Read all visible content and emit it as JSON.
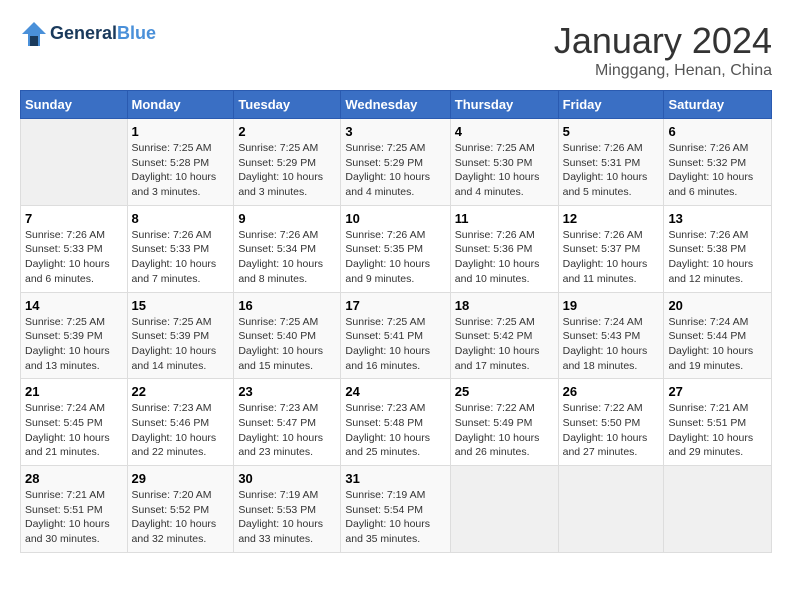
{
  "header": {
    "logo_line1": "General",
    "logo_line2": "Blue",
    "title": "January 2024",
    "subtitle": "Minggang, Henan, China"
  },
  "weekdays": [
    "Sunday",
    "Monday",
    "Tuesday",
    "Wednesday",
    "Thursday",
    "Friday",
    "Saturday"
  ],
  "weeks": [
    [
      {
        "day": "",
        "info": ""
      },
      {
        "day": "1",
        "info": "Sunrise: 7:25 AM\nSunset: 5:28 PM\nDaylight: 10 hours\nand 3 minutes."
      },
      {
        "day": "2",
        "info": "Sunrise: 7:25 AM\nSunset: 5:29 PM\nDaylight: 10 hours\nand 3 minutes."
      },
      {
        "day": "3",
        "info": "Sunrise: 7:25 AM\nSunset: 5:29 PM\nDaylight: 10 hours\nand 4 minutes."
      },
      {
        "day": "4",
        "info": "Sunrise: 7:25 AM\nSunset: 5:30 PM\nDaylight: 10 hours\nand 4 minutes."
      },
      {
        "day": "5",
        "info": "Sunrise: 7:26 AM\nSunset: 5:31 PM\nDaylight: 10 hours\nand 5 minutes."
      },
      {
        "day": "6",
        "info": "Sunrise: 7:26 AM\nSunset: 5:32 PM\nDaylight: 10 hours\nand 6 minutes."
      }
    ],
    [
      {
        "day": "7",
        "info": "Sunrise: 7:26 AM\nSunset: 5:33 PM\nDaylight: 10 hours\nand 6 minutes."
      },
      {
        "day": "8",
        "info": "Sunrise: 7:26 AM\nSunset: 5:33 PM\nDaylight: 10 hours\nand 7 minutes."
      },
      {
        "day": "9",
        "info": "Sunrise: 7:26 AM\nSunset: 5:34 PM\nDaylight: 10 hours\nand 8 minutes."
      },
      {
        "day": "10",
        "info": "Sunrise: 7:26 AM\nSunset: 5:35 PM\nDaylight: 10 hours\nand 9 minutes."
      },
      {
        "day": "11",
        "info": "Sunrise: 7:26 AM\nSunset: 5:36 PM\nDaylight: 10 hours\nand 10 minutes."
      },
      {
        "day": "12",
        "info": "Sunrise: 7:26 AM\nSunset: 5:37 PM\nDaylight: 10 hours\nand 11 minutes."
      },
      {
        "day": "13",
        "info": "Sunrise: 7:26 AM\nSunset: 5:38 PM\nDaylight: 10 hours\nand 12 minutes."
      }
    ],
    [
      {
        "day": "14",
        "info": "Sunrise: 7:25 AM\nSunset: 5:39 PM\nDaylight: 10 hours\nand 13 minutes."
      },
      {
        "day": "15",
        "info": "Sunrise: 7:25 AM\nSunset: 5:39 PM\nDaylight: 10 hours\nand 14 minutes."
      },
      {
        "day": "16",
        "info": "Sunrise: 7:25 AM\nSunset: 5:40 PM\nDaylight: 10 hours\nand 15 minutes."
      },
      {
        "day": "17",
        "info": "Sunrise: 7:25 AM\nSunset: 5:41 PM\nDaylight: 10 hours\nand 16 minutes."
      },
      {
        "day": "18",
        "info": "Sunrise: 7:25 AM\nSunset: 5:42 PM\nDaylight: 10 hours\nand 17 minutes."
      },
      {
        "day": "19",
        "info": "Sunrise: 7:24 AM\nSunset: 5:43 PM\nDaylight: 10 hours\nand 18 minutes."
      },
      {
        "day": "20",
        "info": "Sunrise: 7:24 AM\nSunset: 5:44 PM\nDaylight: 10 hours\nand 19 minutes."
      }
    ],
    [
      {
        "day": "21",
        "info": "Sunrise: 7:24 AM\nSunset: 5:45 PM\nDaylight: 10 hours\nand 21 minutes."
      },
      {
        "day": "22",
        "info": "Sunrise: 7:23 AM\nSunset: 5:46 PM\nDaylight: 10 hours\nand 22 minutes."
      },
      {
        "day": "23",
        "info": "Sunrise: 7:23 AM\nSunset: 5:47 PM\nDaylight: 10 hours\nand 23 minutes."
      },
      {
        "day": "24",
        "info": "Sunrise: 7:23 AM\nSunset: 5:48 PM\nDaylight: 10 hours\nand 25 minutes."
      },
      {
        "day": "25",
        "info": "Sunrise: 7:22 AM\nSunset: 5:49 PM\nDaylight: 10 hours\nand 26 minutes."
      },
      {
        "day": "26",
        "info": "Sunrise: 7:22 AM\nSunset: 5:50 PM\nDaylight: 10 hours\nand 27 minutes."
      },
      {
        "day": "27",
        "info": "Sunrise: 7:21 AM\nSunset: 5:51 PM\nDaylight: 10 hours\nand 29 minutes."
      }
    ],
    [
      {
        "day": "28",
        "info": "Sunrise: 7:21 AM\nSunset: 5:51 PM\nDaylight: 10 hours\nand 30 minutes."
      },
      {
        "day": "29",
        "info": "Sunrise: 7:20 AM\nSunset: 5:52 PM\nDaylight: 10 hours\nand 32 minutes."
      },
      {
        "day": "30",
        "info": "Sunrise: 7:19 AM\nSunset: 5:53 PM\nDaylight: 10 hours\nand 33 minutes."
      },
      {
        "day": "31",
        "info": "Sunrise: 7:19 AM\nSunset: 5:54 PM\nDaylight: 10 hours\nand 35 minutes."
      },
      {
        "day": "",
        "info": ""
      },
      {
        "day": "",
        "info": ""
      },
      {
        "day": "",
        "info": ""
      }
    ]
  ]
}
